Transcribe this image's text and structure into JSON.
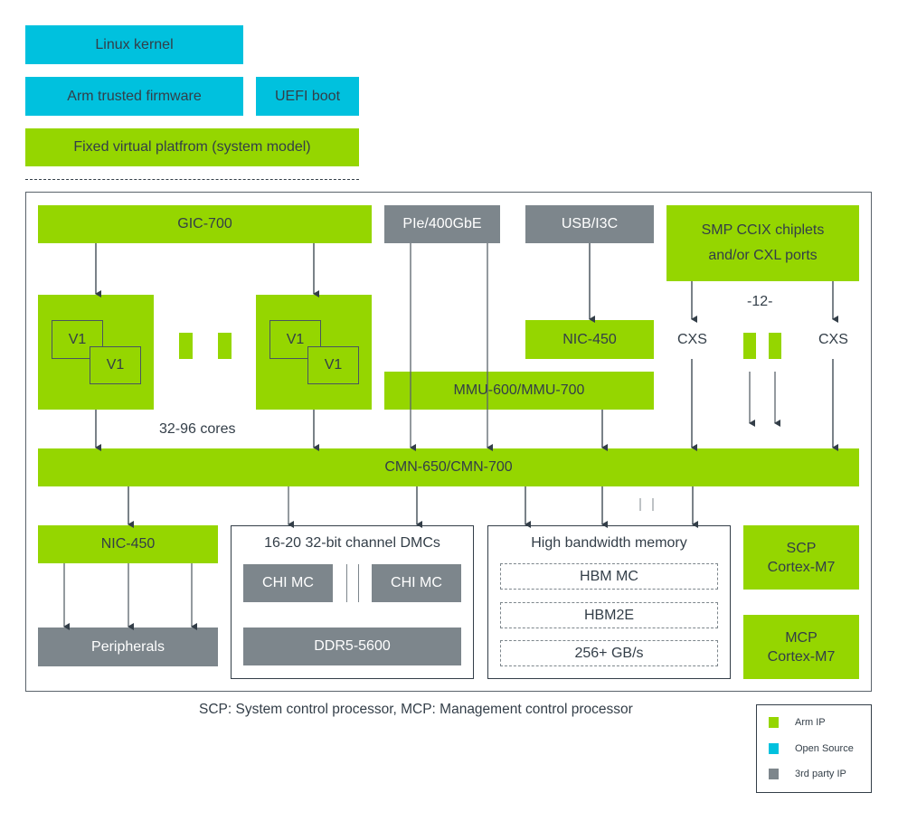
{
  "software_stack": {
    "linux_kernel": "Linux kernel",
    "arm_trusted_firmware": "Arm trusted firmware",
    "uefi_boot": "UEFI boot",
    "fixed_virtual_platform": "Fixed virtual platfrom (system model)"
  },
  "soc": {
    "gic": "GIC-700",
    "pcie": "PIe/400GbE",
    "usb": "USB/I3C",
    "smp_ccix": [
      "SMP CCIX chiplets",
      "and/or CXL ports"
    ],
    "core_cluster": {
      "core_a": "V1",
      "core_b": "V1"
    },
    "cores_label": "32-96 cores",
    "nic_top": "NIC-450",
    "mmu": "MMU-600/MMU-700",
    "cxs_left": "CXS",
    "cxs_right": "CXS",
    "cxs_count": "-12-",
    "interconnect": "CMN-650/CMN-700",
    "nic_bottom": "NIC-450",
    "peripherals": "Peripherals",
    "dmc": {
      "title": "16-20 32-bit channel DMCs",
      "chi_mc_1": "CHI MC",
      "chi_mc_2": "CHI MC",
      "ddr": "DDR5-5600"
    },
    "hbm": {
      "title": "High bandwidth memory",
      "items": [
        "HBM MC",
        "HBM2E",
        "256+ GB/s"
      ]
    },
    "scp": [
      "SCP",
      "Cortex-M7"
    ],
    "mcp": [
      "MCP",
      "Cortex-M7"
    ]
  },
  "footnote": "SCP: System control processor, MCP: Management control processor",
  "legend": {
    "items": [
      {
        "label": "Arm IP",
        "color": "#95d600"
      },
      {
        "label": "Open Source",
        "color": "#00c1de"
      },
      {
        "label": "3rd party IP",
        "color": "#7d868c"
      }
    ]
  },
  "colors": {
    "arm_ip": "#95d600",
    "open_source": "#00c1de",
    "third_party": "#7d868c",
    "line": "#333e48"
  }
}
